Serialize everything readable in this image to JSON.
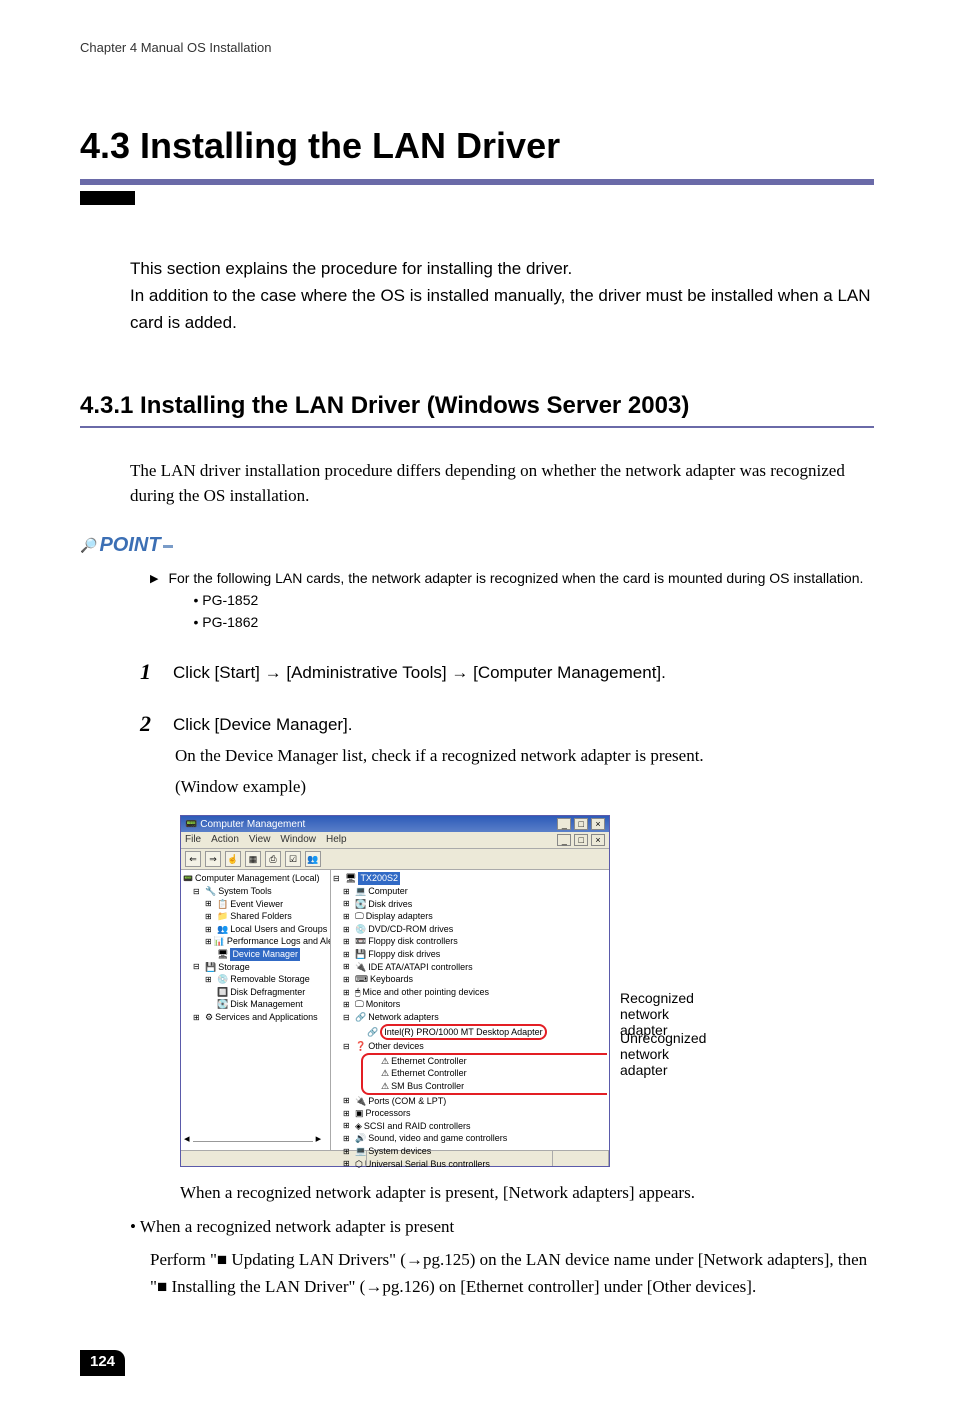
{
  "chapter": "Chapter 4  Manual OS Installation",
  "h_main": "4.3  Installing the LAN Driver",
  "intro1": "This section explains the procedure for installing the driver.",
  "intro2": "In addition to the case where the OS is installed manually, the driver must be installed when a LAN card is added.",
  "h_sub": "4.3.1  Installing the LAN Driver (Windows Server 2003)",
  "body1": "The LAN driver installation procedure differs depending on whether the network adapter was recognized during the OS installation.",
  "point_label": "POINT",
  "point_text": "For the following LAN cards, the network adapter is recognized when the card is mounted during OS installation.",
  "point_b1": "•  PG-1852",
  "point_b2": "•  PG-1862",
  "step1_num": "1",
  "step1": "Click [Start] → [Administrative Tools] → [Computer Management].",
  "step2_num": "2",
  "step2": "Click [Device Manager].",
  "step2_sub1": "On the Device Manager list, check if a recognized network adapter is present.",
  "step2_sub2": "(Window example)",
  "cm": {
    "title": "Computer Management",
    "menu_file": "File",
    "menu_action": "Action",
    "menu_view": "View",
    "menu_window": "Window",
    "menu_help": "Help",
    "left": {
      "root": "Computer Management (Local)",
      "systools": "System Tools",
      "ev": "Event Viewer",
      "sf": "Shared Folders",
      "lug": "Local Users and Groups",
      "pla": "Performance Logs and Alerts",
      "dm": "Device Manager",
      "storage": "Storage",
      "rs": "Removable Storage",
      "dd": "Disk Defragmenter",
      "dmgmt": "Disk Management",
      "sa": "Services and Applications"
    },
    "right": {
      "root": "TX200S2",
      "computer": "Computer",
      "dd": "Disk drives",
      "da": "Display adapters",
      "dvd": "DVD/CD-ROM drives",
      "fdc": "Floppy disk controllers",
      "fdd": "Floppy disk drives",
      "ide": "IDE ATA/ATAPI controllers",
      "kb": "Keyboards",
      "mice": "Mice and other pointing devices",
      "mon": "Monitors",
      "na": "Network adapters",
      "intel": "Intel(R) PRO/1000 MT Desktop Adapter",
      "od": "Other devices",
      "ec1": "Ethernet Controller",
      "ec2": "Ethernet Controller",
      "smb": "SM Bus Controller",
      "ports": "Ports (COM & LPT)",
      "proc": "Processors",
      "scsi": "SCSI and RAID controllers",
      "svgc": "Sound, video and game controllers",
      "sd": "System devices",
      "usb": "Universal Serial Bus controllers"
    }
  },
  "annot1a": "Recognized",
  "annot1b": "network adapter",
  "annot2a": "Unrecognized",
  "annot2b": "network adapter",
  "below1": "When a recognized network adapter is present, [Network adapters] appears.",
  "present_bullet": "•   When a recognized network adapter is present",
  "present1": "Perform \"■ Updating LAN Drivers\" (→pg.125) on the LAN device name under [Network adapters], then \"■ Installing the LAN Driver\" (→pg.126) on [Ethernet controller] under [Other devices].",
  "pagenum": "124"
}
